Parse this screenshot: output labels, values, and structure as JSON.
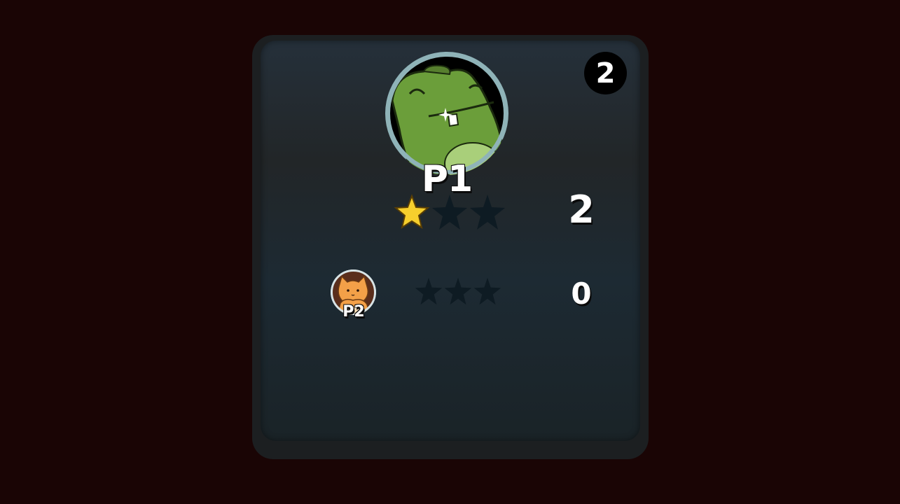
{
  "round": {
    "number": "2"
  },
  "players": [
    {
      "name": "P1",
      "avatar": "frog-avatar",
      "stars_earned": 1,
      "stars_total": 3,
      "score": "2"
    },
    {
      "name": "P2",
      "avatar": "cat-avatar",
      "stars_earned": 0,
      "stars_total": 3,
      "score": "0"
    }
  ],
  "colors": {
    "background": "#1a0505",
    "star_filled": "#f6cf2d",
    "star_empty": "#0e1b23",
    "badge": "#000000",
    "text": "#ffffff"
  }
}
